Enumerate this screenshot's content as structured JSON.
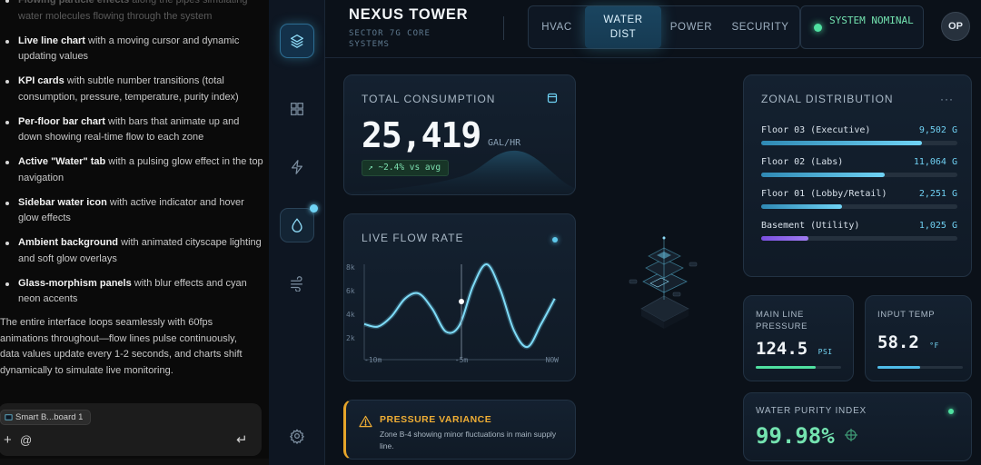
{
  "chat": {
    "items": [
      {
        "bold": "Flowing particle effects",
        "text": " along the pipes simulating water molecules flowing through the system",
        "faded": true
      },
      {
        "bold": "Live line chart",
        "text": " with a moving cursor and dynamic updating values"
      },
      {
        "bold": "KPI cards",
        "text": " with subtle number transitions (total consumption, pressure, temperature, purity index)"
      },
      {
        "bold": "Per-floor bar chart",
        "text": " with bars that animate up and down showing real-time flow to each zone"
      },
      {
        "bold": "Active \"Water\" tab",
        "text": " with a pulsing glow effect in the top navigation"
      },
      {
        "bold": "Sidebar water icon",
        "text": " with active indicator and hover glow effects"
      },
      {
        "bold": "Ambient background",
        "text": " with animated cityscape lighting and soft glow overlays"
      },
      {
        "bold": "Glass-morphism panels",
        "text": " with blur effects and cyan neon accents"
      }
    ],
    "paragraph": "The entire interface loops seamlessly with 60fps animations throughout—flow lines pulse continuously, data values update every 1-2 seconds, and charts shift dynamically to simulate live monitoring.",
    "attachment_chip": "Smart B...board 1",
    "add_icon": "+",
    "mention_icon": "@",
    "send_icon": "↵"
  },
  "header": {
    "title": "NEXUS TOWER",
    "subtitle": "SECTOR 7G CORE SYSTEMS",
    "tabs": [
      {
        "label": "HVAC",
        "active": false
      },
      {
        "label": "WATER DIST",
        "active": true
      },
      {
        "label": "POWER",
        "active": false
      },
      {
        "label": "SECURITY",
        "active": false
      }
    ],
    "status": "SYSTEM NOMINAL",
    "avatar": "OP"
  },
  "sidebar": {
    "icons": [
      "layers-icon",
      "grid-icon",
      "lightning-icon",
      "water-drop-icon",
      "wind-icon",
      "gear-icon"
    ],
    "active": "water-drop-icon"
  },
  "total": {
    "title": "TOTAL CONSUMPTION",
    "value": "25,419",
    "unit": "GAL/HR",
    "trend": "↗ ~2.4% vs avg"
  },
  "flow": {
    "title": "LIVE FLOW RATE",
    "yticks": [
      "8k",
      "6k",
      "4k",
      "2k"
    ],
    "xticks": [
      "-10m",
      "-5m",
      "NOW"
    ]
  },
  "chart_data": {
    "type": "line",
    "title": "LIVE FLOW RATE",
    "xlabel": "",
    "ylabel": "",
    "x_tick_labels": [
      "-10m",
      "-5m",
      "NOW"
    ],
    "y_tick_labels": [
      "8k",
      "6k",
      "4k",
      "2k"
    ],
    "ylim": [
      1000,
      8500
    ],
    "x_range_min": [
      -10,
      0
    ],
    "series": [
      {
        "x": [
          -10.0,
          -9.3,
          -8.6,
          -7.9,
          -7.2,
          -6.5,
          -5.8,
          -5.1,
          -4.4,
          -3.7,
          -3.0,
          -2.3,
          -1.6,
          -0.9,
          -0.2
        ],
        "values": [
          3800,
          3600,
          4400,
          5800,
          6200,
          5000,
          3200,
          3700,
          6800,
          8500,
          6500,
          3300,
          2000,
          3800,
          5800
        ]
      }
    ],
    "cursor_x": -5.0,
    "grid": false,
    "legend": "none"
  },
  "pressure_variance": {
    "title": "PRESSURE VARIANCE",
    "message": "Zone B-4 showing minor fluctuations in main supply line."
  },
  "zonal": {
    "title": "ZONAL DISTRIBUTION",
    "more_icon": "···",
    "zones": [
      {
        "name": "Floor 03 (Executive)",
        "value": "9,502 G",
        "fill": 0.82
      },
      {
        "name": "Floor 02 (Labs)",
        "value": "11,064 G",
        "fill": 0.63
      },
      {
        "name": "Floor 01 (Lobby/Retail)",
        "value": "2,251 G",
        "fill": 0.41
      },
      {
        "name": "Basement (Utility)",
        "value": "1,025 G",
        "fill": 0.24
      }
    ]
  },
  "kpis": {
    "pressure": {
      "label": "MAIN LINE PRESSURE",
      "value": "124.5",
      "unit": "PSI",
      "fill": 0.7,
      "color": "#4fe0a0"
    },
    "temp": {
      "label": "INPUT TEMP",
      "value": "58.2",
      "unit": "°F",
      "fill": 0.5,
      "color": "#4fbce8"
    }
  },
  "purity": {
    "title": "WATER PURITY INDEX",
    "value": "99.98%"
  }
}
